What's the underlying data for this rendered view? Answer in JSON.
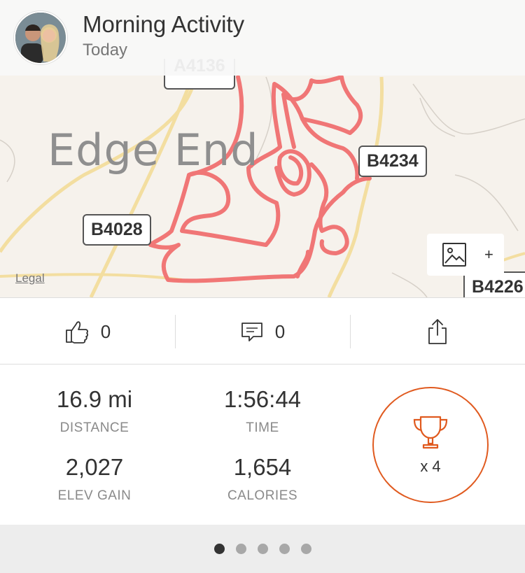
{
  "header": {
    "title": "Morning Activity",
    "subtitle": "Today"
  },
  "map": {
    "place_label": "Edge End",
    "roads": [
      "A4136",
      "B4028",
      "B4234",
      "B4226"
    ],
    "legal": "Legal",
    "photo_add_plus": "+",
    "route_color": "#f07070"
  },
  "actions": {
    "kudos_count": "0",
    "comments_count": "0"
  },
  "stats": {
    "distance_value": "16.9 mi",
    "distance_label": "DISTANCE",
    "time_value": "1:56:44",
    "time_label": "TIME",
    "elev_value": "2,027",
    "elev_label": "ELEV GAIN",
    "calories_value": "1,654",
    "calories_label": "CALORIES",
    "achievements": "x 4",
    "accent": "#e05a1f"
  },
  "pager": {
    "total": 5,
    "active_index": 0
  }
}
